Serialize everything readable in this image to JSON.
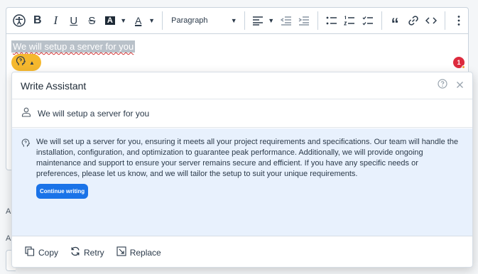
{
  "toolbar": {
    "paragraph_label": "Paragraph"
  },
  "editor": {
    "selected_text": "We will setup a server for you"
  },
  "notification": {
    "count": "1"
  },
  "background": {
    "label_a1": "A",
    "label_a2": "A"
  },
  "assistant": {
    "title": "Write Assistant",
    "prompt": "We will setup a server for you",
    "response": "We will set up a server for you, ensuring it meets all your project requirements and specifications. Our team will handle the installation, configuration, and optimization to guarantee peak performance. Additionally, we will provide ongoing maintenance and support to ensure your server remains secure and efficient. If you have any specific needs or preferences, please let us know, and we will tailor the setup to suit your unique requirements.",
    "continue_label": "Continue writing",
    "copy_label": "Copy",
    "retry_label": "Retry",
    "replace_label": "Replace"
  },
  "colors": {
    "accent": "#1a73e8",
    "ai_trigger": "#f5b82e",
    "response_bg": "#e8f1fd",
    "badge": "#dd2b3e"
  }
}
